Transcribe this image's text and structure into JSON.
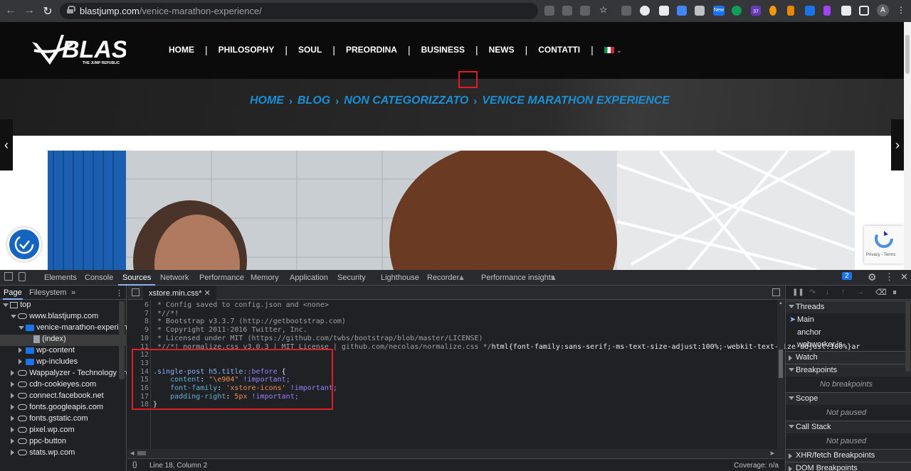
{
  "browser": {
    "url_host": "blastjump.com",
    "url_path": "/venice-marathon-experience/",
    "extension_badges": [
      "New",
      "37"
    ]
  },
  "site": {
    "logo_text": "BLAST",
    "logo_tagline": "THE JUMP REPUBLIC",
    "nav": [
      "HOME",
      "PHILOSOPHY",
      "SOUL",
      "PREORDINA",
      "BUSINESS",
      "NEWS",
      "CONTATTI"
    ],
    "breadcrumb": [
      "HOME",
      "BLOG",
      "NON CATEGORIZZATO",
      "VENICE MARATHON EXPERIENCE"
    ],
    "recaptcha": "Privacy - Terms",
    "accent_color": "#1a8fd6"
  },
  "devtools": {
    "tabs": [
      "Elements",
      "Console",
      "Sources",
      "Network",
      "Performance",
      "Memory",
      "Application",
      "Security",
      "Lighthouse",
      "Recorder",
      "Performance insights"
    ],
    "active_tab": "Sources",
    "issues_count": "2",
    "left_tabs": [
      "Page",
      "Filesystem"
    ],
    "tree": [
      {
        "label": "top",
        "depth": 0,
        "icon": "frame-icon",
        "expanded": true
      },
      {
        "label": "www.blastjump.com",
        "depth": 1,
        "icon": "cloud-icon",
        "expanded": true
      },
      {
        "label": "venice-marathon-experienc",
        "depth": 2,
        "icon": "folder-icon",
        "expanded": true
      },
      {
        "label": "(index)",
        "depth": 3,
        "icon": "file-icon",
        "selected": true
      },
      {
        "label": "wp-content",
        "depth": 2,
        "icon": "folder-icon",
        "expanded": false
      },
      {
        "label": "wp-includes",
        "depth": 2,
        "icon": "folder-icon",
        "expanded": false
      },
      {
        "label": "Wappalyzer - Technology prof",
        "depth": 1,
        "icon": "cloud-icon",
        "expanded": false
      },
      {
        "label": "cdn-cookieyes.com",
        "depth": 1,
        "icon": "cloud-icon",
        "expanded": false
      },
      {
        "label": "connect.facebook.net",
        "depth": 1,
        "icon": "cloud-icon",
        "expanded": false
      },
      {
        "label": "fonts.googleapis.com",
        "depth": 1,
        "icon": "cloud-icon",
        "expanded": false
      },
      {
        "label": "fonts.gstatic.com",
        "depth": 1,
        "icon": "cloud-icon",
        "expanded": false
      },
      {
        "label": "pixel.wp.com",
        "depth": 1,
        "icon": "cloud-icon",
        "expanded": false
      },
      {
        "label": "ppc-button",
        "depth": 1,
        "icon": "cloud-icon",
        "expanded": false
      },
      {
        "label": "stats.wp.com",
        "depth": 1,
        "icon": "cloud-icon",
        "expanded": false
      }
    ],
    "editor_tab": "xstore.min.css*",
    "code_lines": [
      {
        "n": "6",
        "text": " * Config saved to config.json and <none>"
      },
      {
        "n": "7",
        "text": " *//*!"
      },
      {
        "n": "8",
        "text": " * Bootstrap v3.3.7 (http://getbootstrap.com)"
      },
      {
        "n": "9",
        "text": " * Copyright 2011-2016 Twitter, Inc."
      },
      {
        "n": "10",
        "text": " * Licensed under MIT (https://github.com/twbs/bootstrap/blob/master/LICENSE)"
      },
      {
        "n": "11",
        "text": " *//*! normalize.css v3.0.3 | MIT License | github.com/necolas/normalize.css */"
      },
      {
        "n": "12",
        "text": ""
      },
      {
        "n": "13",
        "text": ""
      },
      {
        "n": "14",
        "text": ""
      },
      {
        "n": "15",
        "text": ""
      },
      {
        "n": "16",
        "text": ""
      },
      {
        "n": "17",
        "text": ""
      },
      {
        "n": "18",
        "text": "}"
      }
    ],
    "line11_tail": "html{font-family:sans-serif;-ms-text-size-adjust:100%;-webkit-text-size-adjust:100%}ar",
    "rule": {
      "selector": ".single-post h5.title",
      "pseudo": "::before",
      "brace_open": " {",
      "decls": [
        {
          "prop": "content",
          "value": "\"\\e904\"",
          "flag": "!important;"
        },
        {
          "prop": "font-family",
          "value": "'xstore-icons'",
          "flag": "!important;"
        },
        {
          "prop": "padding-right",
          "value": "5px",
          "flag": "!important;"
        }
      ]
    },
    "status_position": "Line 18, Column 2",
    "coverage": "Coverage: n/a",
    "right": {
      "threads": "Threads",
      "thread_items": [
        "Main",
        "anchor",
        "webworker.js"
      ],
      "watch": "Watch",
      "breakpoints": "Breakpoints",
      "no_breakpoints": "No breakpoints",
      "scope": "Scope",
      "not_paused": "Not paused",
      "call_stack": "Call Stack",
      "xhr": "XHR/fetch Breakpoints",
      "dom": "DOM Breakpoints"
    }
  }
}
